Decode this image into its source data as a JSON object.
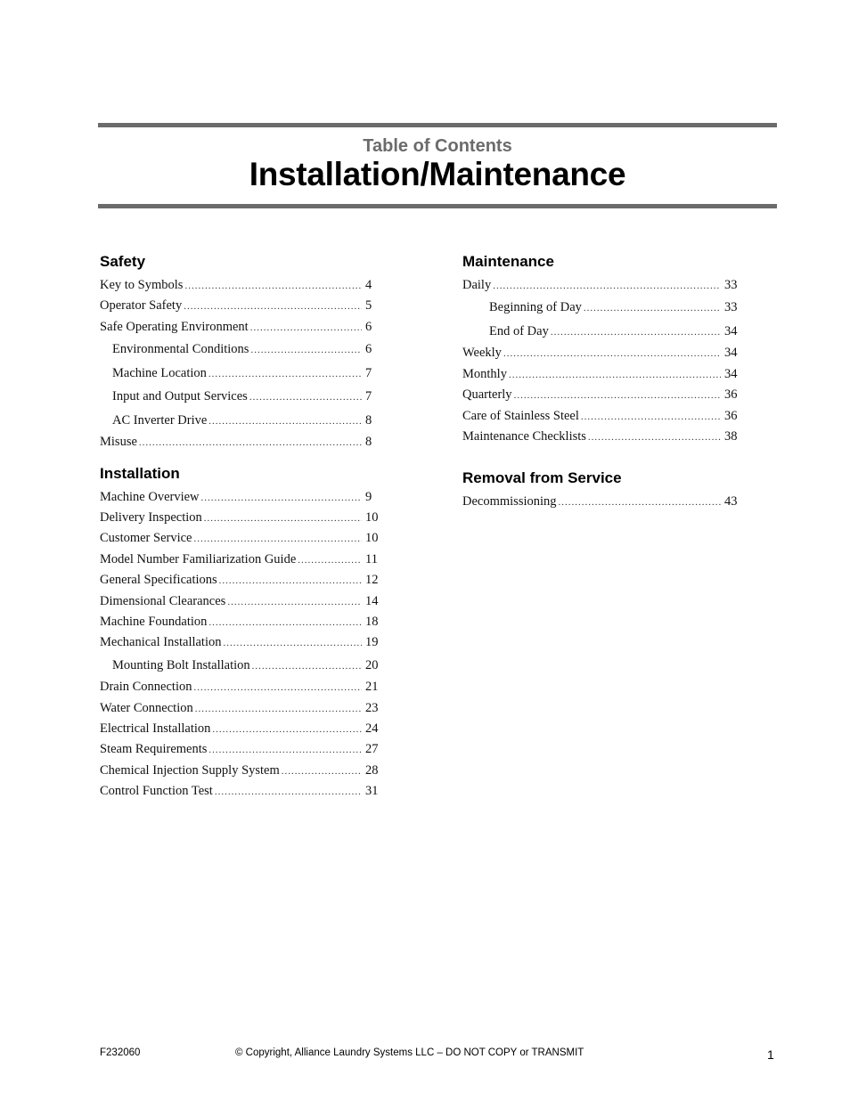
{
  "header": {
    "subtitle": "Table of Contents",
    "title": "Installation/Maintenance"
  },
  "sections": {
    "safety": {
      "heading": "Safety",
      "entries": [
        {
          "label": "Key to Symbols",
          "page": "4",
          "level": 0
        },
        {
          "label": "Operator Safety",
          "page": "5",
          "level": 0
        },
        {
          "label": "Safe Operating Environment",
          "page": "6",
          "level": 0
        },
        {
          "label": "Environmental Conditions",
          "page": "6",
          "level": 1
        },
        {
          "label": "Machine Location",
          "page": "7",
          "level": 1
        },
        {
          "label": "Input and Output Services",
          "page": "7",
          "level": 1
        },
        {
          "label": "AC Inverter Drive",
          "page": "8",
          "level": 1
        },
        {
          "label": "Misuse",
          "page": "8",
          "level": 0
        }
      ]
    },
    "installation": {
      "heading": "Installation",
      "entries": [
        {
          "label": "Machine Overview",
          "page": "9",
          "level": 0
        },
        {
          "label": "Delivery Inspection",
          "page": "10",
          "level": 0
        },
        {
          "label": "Customer Service",
          "page": "10",
          "level": 0
        },
        {
          "label": "Model Number Familiarization Guide",
          "page": "11",
          "level": 0
        },
        {
          "label": "General Specifications",
          "page": "12",
          "level": 0
        },
        {
          "label": "Dimensional Clearances",
          "page": "14",
          "level": 0
        },
        {
          "label": "Machine Foundation",
          "page": "18",
          "level": 0
        },
        {
          "label": "Mechanical Installation",
          "page": "19",
          "level": 0
        },
        {
          "label": "Mounting Bolt Installation",
          "page": "20",
          "level": 1
        },
        {
          "label": "Drain Connection",
          "page": "21",
          "level": 0
        },
        {
          "label": "Water Connection",
          "page": "23",
          "level": 0
        },
        {
          "label": "Electrical Installation",
          "page": "24",
          "level": 0
        },
        {
          "label": "Steam Requirements",
          "page": "27",
          "level": 0
        },
        {
          "label": "Chemical Injection Supply System",
          "page": "28",
          "level": 0
        },
        {
          "label": "Control Function Test",
          "page": "31",
          "level": 0
        }
      ]
    },
    "maintenance": {
      "heading": "Maintenance",
      "entries": [
        {
          "label": "Daily",
          "page": "33",
          "level": 0
        },
        {
          "label": "Beginning of Day",
          "page": "33",
          "level": 2
        },
        {
          "label": "End of Day",
          "page": "34",
          "level": 2
        },
        {
          "label": "Weekly",
          "page": "34",
          "level": 0
        },
        {
          "label": "Monthly",
          "page": "34",
          "level": 0
        },
        {
          "label": "Quarterly",
          "page": "36",
          "level": 0
        },
        {
          "label": "Care of Stainless Steel",
          "page": "36",
          "level": 0
        },
        {
          "label": "Maintenance Checklists",
          "page": "38",
          "level": 0
        }
      ]
    },
    "removal": {
      "heading": "Removal from Service",
      "entries": [
        {
          "label": "Decommissioning",
          "page": "43",
          "level": 0
        }
      ]
    }
  },
  "footer": {
    "doc_code": "F232060",
    "copyright": "© Copyright, Alliance Laundry Systems LLC – DO NOT COPY or TRANSMIT",
    "page_number": "1"
  }
}
